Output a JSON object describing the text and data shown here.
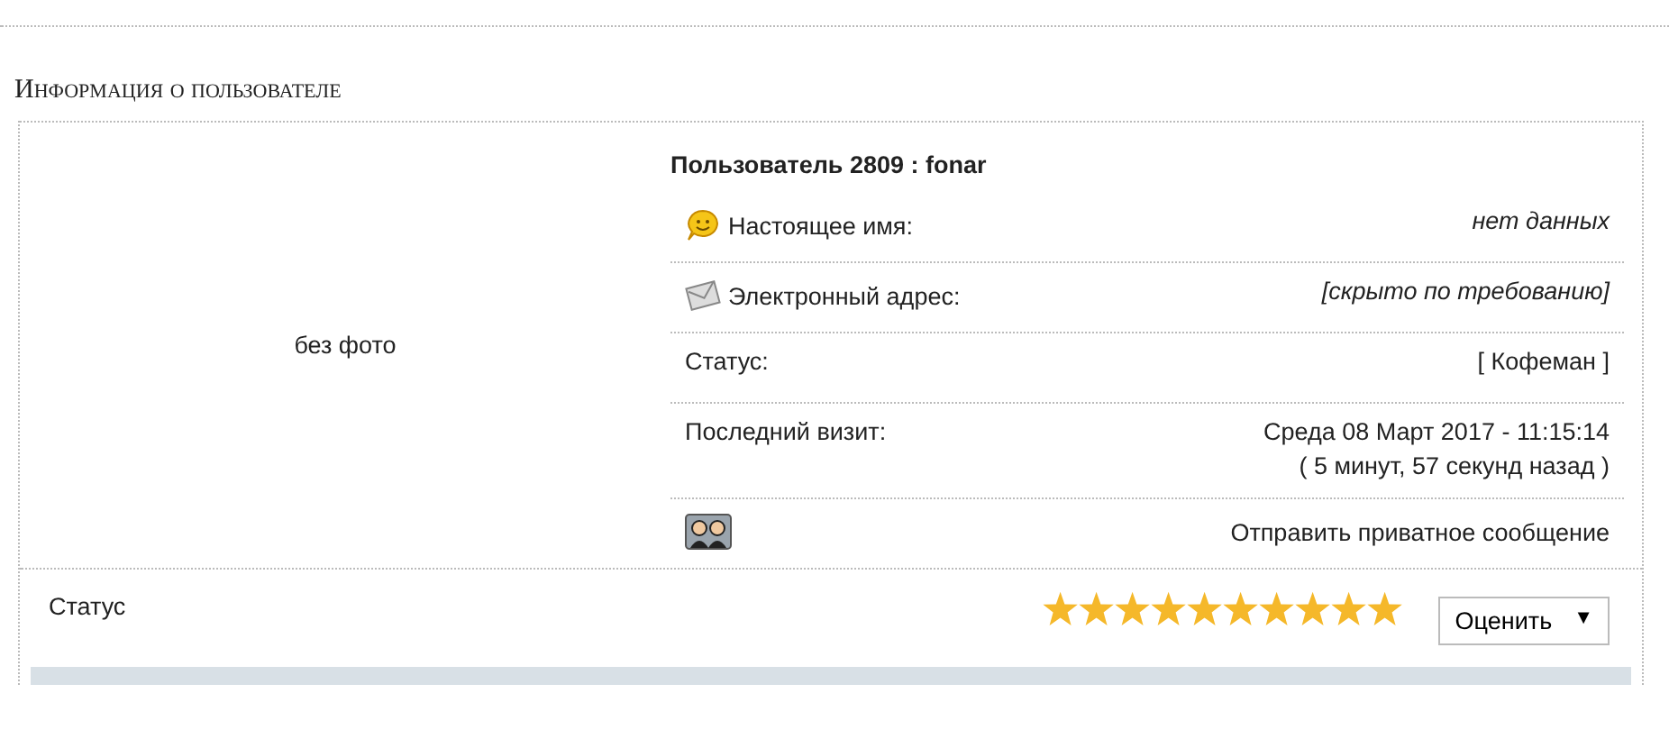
{
  "section_title": "Информация о пользователе",
  "photo_text": "без фото",
  "user_title": "Пользователь 2809 : fonar",
  "fields": [
    {
      "kind": "smile",
      "label": "Настоящее имя:",
      "value": [
        "нет данных"
      ],
      "italic": true
    },
    {
      "kind": "envelope",
      "label": "Электронный адрес:",
      "value": [
        "[скрыто по требованию]"
      ],
      "italic": true
    },
    {
      "kind": "plain",
      "label": "Статус:",
      "value": [
        "[ Кофеман ]"
      ],
      "italic": false
    },
    {
      "kind": "plain",
      "label": "Последний визит:",
      "value": [
        "Среда 08 Март 2017 - 11:15:14",
        "( 5 минут, 57 секунд назад )"
      ],
      "italic": false
    }
  ],
  "pm_link": "Отправить приватное сообщение",
  "rating": {
    "label": "Статус",
    "stars": 10,
    "button": "Оценить",
    "caret": "▼"
  }
}
